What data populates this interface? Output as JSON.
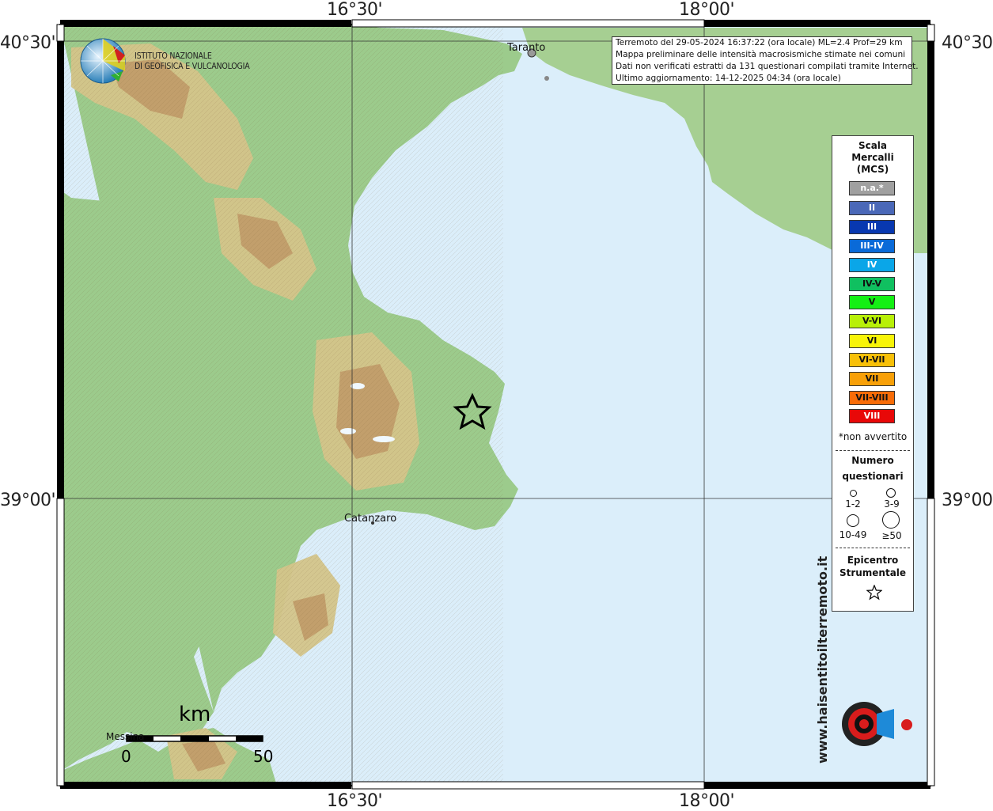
{
  "coords": {
    "top": [
      "16°30'",
      "18°00'"
    ],
    "bottom": [
      "16°30'",
      "18°00'"
    ],
    "left": [
      "40°30'",
      "39°00'"
    ],
    "right": [
      "40°30'",
      "39°00'"
    ]
  },
  "logo": {
    "line1": "ISTITUTO NAZIONALE",
    "line2": "DI GEOFISICA E VULCANOLOGIA"
  },
  "info": {
    "line1": "Terremoto del 29-05-2024 16:37:22 (ora locale) ML=2.4 Prof=29 km",
    "line2": "Mappa preliminare delle intensità macrosismiche stimate nei comuni",
    "line3": "Dati non verificati estratti da 131 questionari compilati tramite Internet.",
    "line4": "Ultimo aggiornamento: 14-12-2025 04:34 (ora locale)"
  },
  "cities": {
    "taranto": "Taranto",
    "catanzaro": "Catanzaro",
    "messina": "Messina"
  },
  "legend": {
    "title1": "Scala",
    "title2": "Mercalli",
    "title3": "(MCS)",
    "classes": [
      {
        "label": "n.a.*",
        "color": "#a0a0a0",
        "text": "#ffffff"
      },
      {
        "label": "II",
        "color": "#4a68b8",
        "text": "#ffffff"
      },
      {
        "label": "III",
        "color": "#0838b0",
        "text": "#ffffff"
      },
      {
        "label": "III-IV",
        "color": "#0a6ad8",
        "text": "#ffffff"
      },
      {
        "label": "IV",
        "color": "#0aa6e8",
        "text": "#ffffff"
      },
      {
        "label": "IV-V",
        "color": "#10c060",
        "text": "#111111"
      },
      {
        "label": "V",
        "color": "#14f014",
        "text": "#111111"
      },
      {
        "label": "V-VI",
        "color": "#b8f008",
        "text": "#111111"
      },
      {
        "label": "VI",
        "color": "#f8f408",
        "text": "#111111"
      },
      {
        "label": "VI-VII",
        "color": "#f8c008",
        "text": "#111111"
      },
      {
        "label": "VII",
        "color": "#f8a008",
        "text": "#111111"
      },
      {
        "label": "VII-VIII",
        "color": "#f86c08",
        "text": "#111111"
      },
      {
        "label": "VIII",
        "color": "#e80808",
        "text": "#ffffff"
      }
    ],
    "note": "*non avvertito",
    "count_title1": "Numero",
    "count_title2": "questionari",
    "counts": [
      "1-2",
      "3-9",
      "10-49",
      "≥50"
    ],
    "epi_title1": "Epicentro",
    "epi_title2": "Strumentale"
  },
  "scale": {
    "unit": "km",
    "start": "0",
    "end": "50"
  },
  "watermark": {
    "text": "www.haisentitoilterremoto.it"
  },
  "colors": {
    "sea": "#dbeefa",
    "land_low": "#9ccb8c",
    "land_mid": "#d4c48a",
    "land_high": "#c09a68"
  }
}
